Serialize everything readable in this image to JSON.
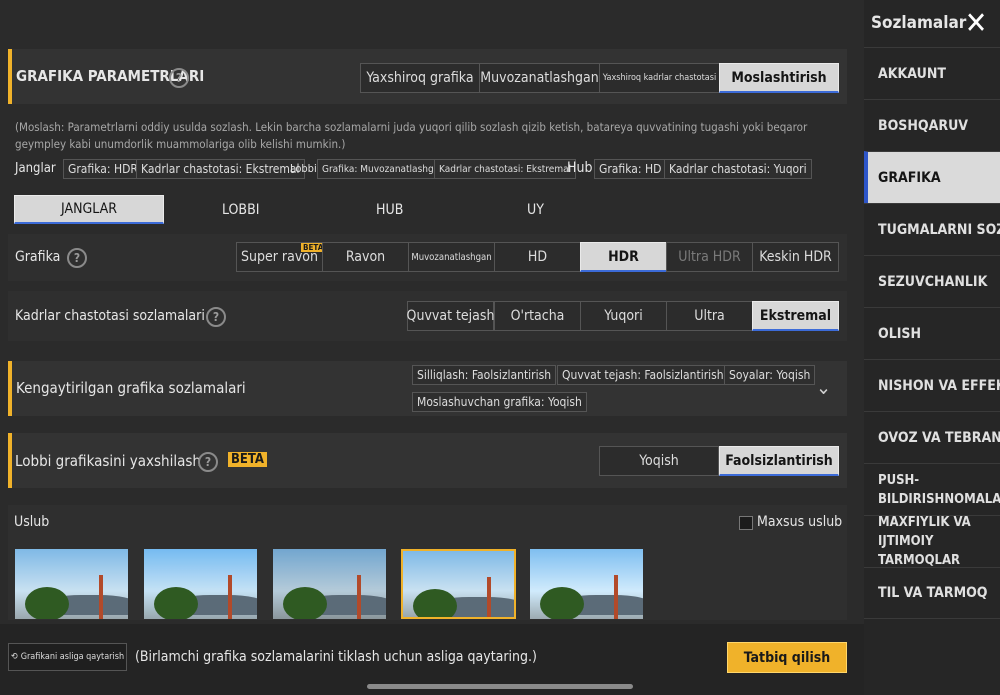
{
  "header": {
    "title": "Sozlamalar"
  },
  "sidebar": {
    "items": [
      {
        "label": "AKKAUNT"
      },
      {
        "label": "BOSHQARUV"
      },
      {
        "label": "GRAFIKA"
      },
      {
        "label": "TUGMALARNI SOZLASH"
      },
      {
        "label": "SEZUVCHANLIK"
      },
      {
        "label": "OLISH"
      },
      {
        "label": "NISHON VA EFFEKTLAR"
      },
      {
        "label": "OVOZ VA TEBRANISH"
      },
      {
        "label": "PUSH-BILDIRISHNOMALAR"
      },
      {
        "label": "MAXFIYLIK VA IJTIMOIY TARMOQLAR"
      },
      {
        "label": "TIL VA TARMOQ"
      }
    ]
  },
  "graphics_params": {
    "title": "GRAFIKA PARAMETRLARI",
    "presets": [
      "Yaxshiroq grafika",
      "Muvozanatlashgan",
      "Yaxshiroq kadrlar chastotasi",
      "Moslashtirish"
    ],
    "description": "(Moslash: Parametrlarni oddiy usulda sozlash. Lekin barcha sozlamalarni juda yuqori qilib sozlash qizib ketish, batareya quvvatining tugashi yoki beqaror geympley kabi unumdorlik muammolariga olib kelishi mumkin.)",
    "summary": {
      "janglar_label": "Janglar",
      "janglar_grafika": "Grafika: HDR",
      "janglar_fps": "Kadrlar chastotasi: Ekstremal",
      "lobbi_label": "Lobbi",
      "lobbi_grafika": "Grafika: Muvozanatlashgan",
      "lobbi_fps": "Kadrlar chastotasi: Ekstremal",
      "hub_label": "Hub",
      "hub_grafika": "Grafika: HD",
      "hub_fps": "Kadrlar chastotasi: Yuqori"
    }
  },
  "mode_tabs": [
    "JANGLAR",
    "LOBBI",
    "HUB",
    "UY"
  ],
  "grafika": {
    "label": "Grafika",
    "options": [
      "Super ravon",
      "Ravon",
      "Muvozanatlashgan",
      "HD",
      "HDR",
      "Ultra HDR",
      "Keskin HDR"
    ],
    "beta": "BETA"
  },
  "fps": {
    "label": "Kadrlar chastotasi sozlamalari",
    "options": [
      "Quvvat tejash",
      "O'rtacha",
      "Yuqori",
      "Ultra",
      "Ekstremal"
    ]
  },
  "advanced": {
    "title": "Kengaytirilgan grafika sozlamalari",
    "chips": [
      "Silliqlash: Faolsizlantirish",
      "Quvvat tejash: Faolsizlantirish",
      "Soyalar: Yoqish",
      "Moslashuvchan grafika: Yoqish"
    ]
  },
  "lobby_enhance": {
    "title": "Lobbi grafikasini yaxshilash",
    "badge": "BETA",
    "options": [
      "Yoqish",
      "Faolsizlantirish"
    ]
  },
  "style": {
    "title": "Uslub",
    "custom_label": "Maxsus uslub"
  },
  "footer": {
    "reset_label": "Grafikani asliga qaytarish",
    "reset_hint": "(Birlamchi grafika sozlamalarini tiklash uchun asliga qaytaring.)",
    "apply_label": "Tatbiq qilish"
  },
  "colors": {
    "accent": "#f0b22a",
    "selected": "#d7d7d7",
    "active_line": "#3c6bd8"
  }
}
